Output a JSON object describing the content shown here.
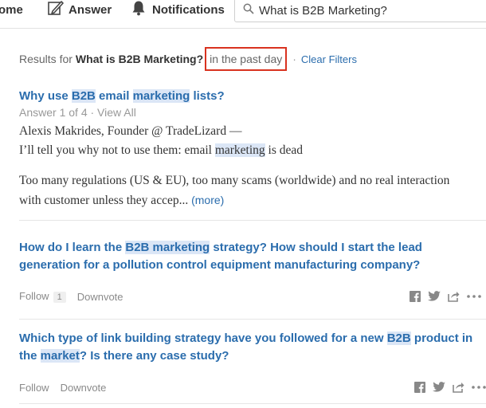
{
  "nav": {
    "home_label": "ome",
    "answer_label": "Answer",
    "notifications_label": "Notifications"
  },
  "search": {
    "value": "What is B2B Marketing?"
  },
  "results_header": {
    "prefix": "Results for",
    "query": "What is B2B Marketing?",
    "time_filter": "in the past day",
    "separator": "·",
    "clear_filters": "Clear Filters"
  },
  "results": [
    {
      "title_parts": [
        "Why use ",
        "B2B",
        " email ",
        "marketing",
        " lists?"
      ],
      "answer_meta": "Answer 1 of 4 · View All",
      "author_line": "Alexis Makrides, Founder @ TradeLizard —",
      "line2_parts": [
        "I’ll tell you why not to use them: email ",
        "marketing",
        " is dead"
      ],
      "para2": "Too many regulations (US & EU), too many scams (worldwide) and no real interaction with customer unless they accep...",
      "more_label": "(more)"
    },
    {
      "title_parts": [
        "How do I learn the ",
        "B2B marketing",
        " strategy? How should I start the lead generation for a pollution control equipment manufacturing company?"
      ],
      "follow_label": "Follow",
      "follow_count": "1",
      "downvote_label": "Downvote"
    },
    {
      "title_parts": [
        "Which type of link building strategy have you followed for a new ",
        "B2B",
        " product in the ",
        "market",
        "? Is there any case study?"
      ],
      "follow_label": "Follow",
      "downvote_label": "Downvote"
    }
  ],
  "colors": {
    "link": "#2b6dad",
    "highlight": "#dbe6f6",
    "filter_box": "#d9321f"
  },
  "icons": {
    "answer": "pencil-icon",
    "notifications": "bell-icon",
    "search": "search-icon",
    "facebook": "facebook-icon",
    "twitter": "twitter-icon",
    "share": "share-icon",
    "more": "more-options-icon"
  }
}
